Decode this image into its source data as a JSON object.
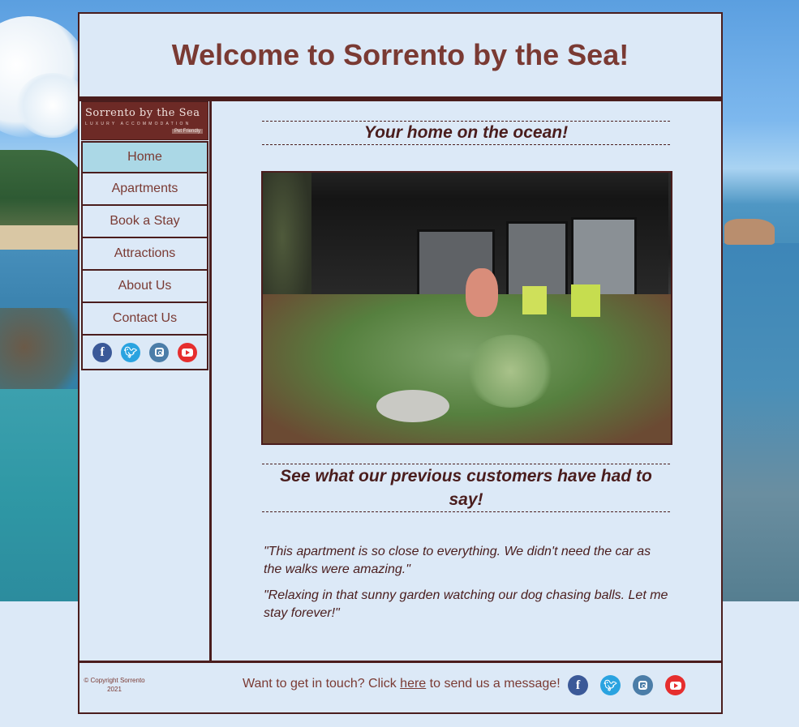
{
  "header": {
    "title": "Welcome to Sorrento by the Sea!"
  },
  "logo": {
    "name": "Sorrento by the Sea",
    "tagline": "LUXURY ACCOMMODATION",
    "badge": "Pet Friendly"
  },
  "nav": {
    "items": [
      {
        "label": "Home",
        "active": true
      },
      {
        "label": "Apartments"
      },
      {
        "label": "Book a Stay"
      },
      {
        "label": "Attractions"
      },
      {
        "label": "About Us"
      },
      {
        "label": "Contact Us"
      }
    ],
    "social": [
      "facebook-icon",
      "twitter-icon",
      "instagram-icon",
      "youtube-icon"
    ]
  },
  "main": {
    "heading": "Your home on the ocean!",
    "reviews_heading": "See what our previous customers have had to say!",
    "quotes": [
      "\"This apartment is so close to everything. We didn't need the car as the walks were amazing.\"",
      "\"Relaxing in that sunny garden watching our dog chasing balls. Let me stay forever!\""
    ]
  },
  "footer": {
    "copyright_line1": "© Copyright Sorrento",
    "copyright_line2": "2021",
    "contact_before": "Want to get in touch? Click ",
    "contact_link": "here",
    "contact_after": " to send us a message!"
  },
  "colors": {
    "accent": "#7a3a33",
    "border": "#4a1d1d",
    "page_bg": "#dce9f7",
    "nav_active": "#abd8e6"
  }
}
